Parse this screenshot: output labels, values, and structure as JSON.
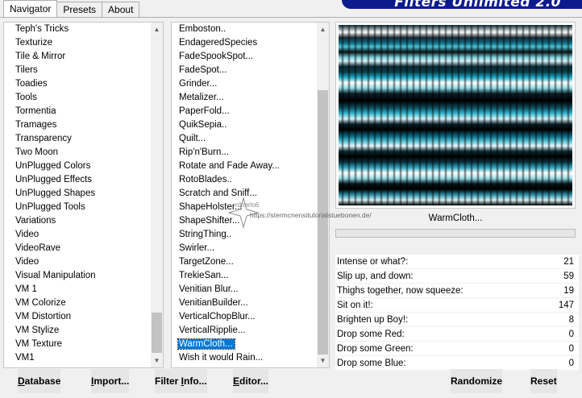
{
  "tabs": [
    {
      "label": "Navigator",
      "active": true
    },
    {
      "label": "Presets",
      "active": false
    },
    {
      "label": "About",
      "active": false
    }
  ],
  "banner_title": "Filters Unlimited 2.0",
  "categories": [
    "Teph's Tricks",
    "Texturize",
    "Tile & Mirror",
    "Tilers",
    "Toadies",
    "Tools",
    "Tormentia",
    "Tramages",
    "Transparency",
    "Two Moon",
    "UnPlugged Colors",
    "UnPlugged Effects",
    "UnPlugged Shapes",
    "UnPlugged Tools",
    "Variations",
    "Video",
    "VideoRave",
    "Video",
    "Visual Manipulation",
    "VM 1",
    "VM Colorize",
    "VM Distortion",
    "VM Stylize",
    "VM Texture",
    "VM1"
  ],
  "filters": [
    "Emboston..",
    "EndageredSpecies",
    "FadeSpookSpot...",
    "FadeSpot...",
    "Grinder...",
    "Metalizer...",
    "PaperFold...",
    "QuikSepia..",
    "Quilt...",
    "Rip'n'Burn...",
    "Rotate and Fade Away...",
    "RotoBlades..",
    "Scratch and Sniff...",
    "ShapeHolster...",
    "ShapeShifter...",
    "StringThing..",
    "Swirler...",
    "TargetZone...",
    "TrekieSan...",
    "Venitian Blur...",
    "VenitianBuilder...",
    "VerticalChopBlur...",
    "VerticalRipplie...",
    "WarmCloth...",
    "Wish it would Rain..."
  ],
  "selected_filter": "WarmCloth...",
  "preview": {
    "filter_name": "WarmCloth..."
  },
  "watermark": {
    "name": "rdnerlo6",
    "url": "https://stermcnensitutorialstuebonen.de/"
  },
  "params": [
    {
      "label": "Intense or what?:",
      "value": "21"
    },
    {
      "label": "Slip up, and down:",
      "value": "59"
    },
    {
      "label": "Thighs together, now squeeze:",
      "value": "19"
    },
    {
      "label": "Sit on it!:",
      "value": "147"
    },
    {
      "label": "Brighten up Boy!:",
      "value": "8"
    },
    {
      "label": "Drop some Red:",
      "value": "0"
    },
    {
      "label": "Drop some Green:",
      "value": "0"
    },
    {
      "label": "Drop some Blue:",
      "value": "0"
    }
  ],
  "buttons": {
    "database": {
      "u": "D",
      "rest": "atabase"
    },
    "import": {
      "u": "I",
      "rest": "mport..."
    },
    "filter_info": {
      "pre": "Filter ",
      "u": "I",
      "rest": "nfo..."
    },
    "editor": {
      "u": "E",
      "rest": "ditor..."
    },
    "randomize": "Randomize",
    "reset": "Reset"
  },
  "colors": {
    "banner": "#0c1b8c",
    "selection": "#0078d7"
  }
}
